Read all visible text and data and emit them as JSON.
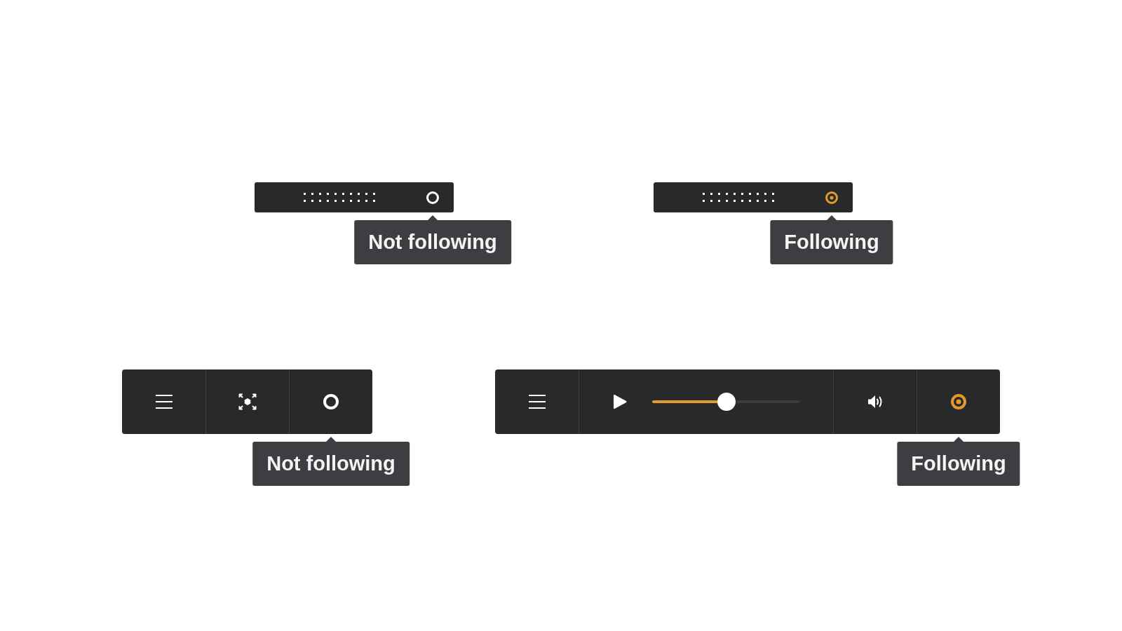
{
  "compact_players": [
    {
      "following": false,
      "tooltip": "Not following"
    },
    {
      "following": true,
      "tooltip": "Following"
    }
  ],
  "toolbars": [
    {
      "controls": [
        {
          "kind": "menu"
        },
        {
          "kind": "focus"
        },
        {
          "kind": "follow",
          "following": false,
          "tooltip": "Not following"
        }
      ]
    },
    {
      "controls": [
        {
          "kind": "menu"
        },
        {
          "kind": "playback",
          "level": 0.5
        },
        {
          "kind": "volume"
        },
        {
          "kind": "follow",
          "following": true,
          "tooltip": "Following"
        }
      ]
    }
  ]
}
